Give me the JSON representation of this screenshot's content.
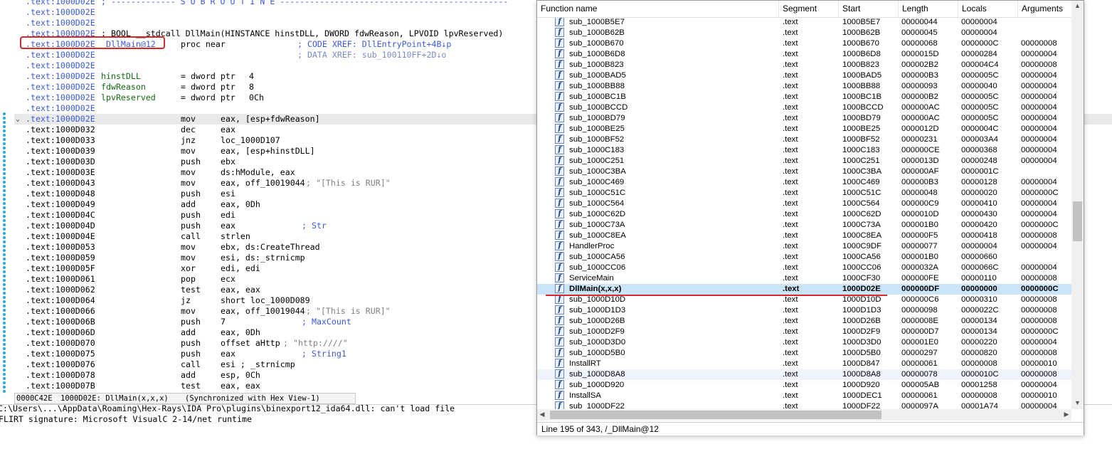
{
  "disasm": {
    "lines": [
      {
        "addr": ".text:1000D02E",
        "ab": true,
        "label": "; ------------- S U B R O U T I N E ----------------------------------------------",
        "lc": "cmt"
      },
      {
        "addr": ".text:1000D02E",
        "ab": true
      },
      {
        "addr": ".text:1000D02E",
        "ab": true
      },
      {
        "addr": ".text:1000D02E",
        "ab": true,
        "label": "; BOOL __stdcall DllMain(HINSTANCE hinstDLL, DWORD fdwReason, LPVOID lpvReserved)",
        "lc": "black"
      },
      {
        "addr": ".text:1000D02E",
        "ab": true,
        "label": "_DllMain@12",
        "lc": "blue",
        "mn": "proc near",
        "cmt": "; CODE XREF: DllEntryPoint+4B↓p",
        "cc": "xref"
      },
      {
        "addr": ".text:1000D02E",
        "ab": true,
        "cmt": "; DATA XREF: sub_100110FF+2D↓o",
        "cc": "xref2"
      },
      {
        "addr": ".text:1000D02E",
        "ab": true
      },
      {
        "addr": ".text:1000D02E",
        "ab": true,
        "label": "hinstDLL",
        "lc": "green",
        "mn": "= dword ptr",
        "op": "4"
      },
      {
        "addr": ".text:1000D02E",
        "ab": true,
        "label": "fdwReason",
        "lc": "green",
        "mn": "= dword ptr",
        "op": "8"
      },
      {
        "addr": ".text:1000D02E",
        "ab": true,
        "label": "lpvReserved",
        "lc": "green",
        "mn": "= dword ptr",
        "op": "0Ch"
      },
      {
        "addr": ".text:1000D02E",
        "ab": true
      },
      {
        "addr": ".text:1000D02E",
        "ab": true,
        "mn": "mov",
        "op": "eax, [esp+fdwReason]",
        "hl": true
      },
      {
        "addr": ".text:1000D032",
        "mn": "dec",
        "op": "eax"
      },
      {
        "addr": ".text:1000D033",
        "mn": "jnz",
        "op": "loc_1000D107"
      },
      {
        "addr": ".text:1000D039",
        "mn": "mov",
        "op": "eax, [esp+hinstDLL]"
      },
      {
        "addr": ".text:1000D03D",
        "mn": "push",
        "op": "ebx"
      },
      {
        "addr": ".text:1000D03E",
        "mn": "mov",
        "op": "ds:hModule, eax"
      },
      {
        "addr": ".text:1000D043",
        "mn": "mov",
        "op": "eax, off_10019044",
        "cmt": "; \"[This is RUR]\"",
        "cc": "str"
      },
      {
        "addr": ".text:1000D048",
        "mn": "push",
        "op": "esi"
      },
      {
        "addr": ".text:1000D049",
        "mn": "add",
        "op": "eax, 0Dh"
      },
      {
        "addr": ".text:1000D04C",
        "mn": "push",
        "op": "edi"
      },
      {
        "addr": ".text:1000D04D",
        "mn": "push",
        "op": "eax",
        "cmt": "; Str",
        "cc": "cmt"
      },
      {
        "addr": ".text:1000D04E",
        "mn": "call",
        "op": "strlen"
      },
      {
        "addr": ".text:1000D053",
        "mn": "mov",
        "op": "ebx, ds:CreateThread"
      },
      {
        "addr": ".text:1000D059",
        "mn": "mov",
        "op": "esi, ds:_strnicmp"
      },
      {
        "addr": ".text:1000D05F",
        "mn": "xor",
        "op": "edi, edi"
      },
      {
        "addr": ".text:1000D061",
        "mn": "pop",
        "op": "ecx"
      },
      {
        "addr": ".text:1000D062",
        "mn": "test",
        "op": "eax, eax"
      },
      {
        "addr": ".text:1000D064",
        "mn": "jz",
        "op": "short loc_1000D089"
      },
      {
        "addr": ".text:1000D066",
        "mn": "mov",
        "op": "eax, off_10019044",
        "cmt": "; \"[This is RUR]\"",
        "cc": "str"
      },
      {
        "addr": ".text:1000D06B",
        "mn": "push",
        "op": "7",
        "cmt": "; MaxCount",
        "cc": "cmt"
      },
      {
        "addr": ".text:1000D06D",
        "mn": "add",
        "op": "eax, 0Dh"
      },
      {
        "addr": ".text:1000D070",
        "mn": "push",
        "op": "offset aHttp",
        "cmt": "; \"http:////\"",
        "cc": "str"
      },
      {
        "addr": ".text:1000D075",
        "mn": "push",
        "op": "eax",
        "cmt": "; String1",
        "cc": "cmt"
      },
      {
        "addr": ".text:1000D076",
        "mn": "call",
        "op": "esi ; _strnicmp"
      },
      {
        "addr": ".text:1000D078",
        "mn": "add",
        "op": "esp, 0Ch"
      },
      {
        "addr": ".text:1000D07B",
        "mn": "test",
        "op": "eax, eax"
      }
    ],
    "status": {
      "offset": "0000C42E",
      "location": "1000D02E: DllMain(x,x,x)",
      "sync": "(Synchronized with Hex View-1)"
    }
  },
  "output": {
    "line1": "C:\\Users\\...\\AppData\\Roaming\\Hex-Rays\\IDA Pro\\plugins\\binexport12_ida64.dll: can't load file",
    "line2": "FLIRT signature: Microsoft VisualC 2-14/net runtime"
  },
  "functions": {
    "headers": {
      "name": "Function name",
      "segment": "Segment",
      "start": "Start",
      "length": "Length",
      "locals": "Locals",
      "arguments": "Arguments"
    },
    "rows": [
      [
        "sub_1000B5E7",
        ".text",
        "1000B5E7",
        "00000044",
        "00000004",
        ""
      ],
      [
        "sub_1000B62B",
        ".text",
        "1000B62B",
        "00000045",
        "00000004",
        ""
      ],
      [
        "sub_1000B670",
        ".text",
        "1000B670",
        "00000068",
        "0000000C",
        "00000008"
      ],
      [
        "sub_1000B6D8",
        ".text",
        "1000B6D8",
        "0000015D",
        "00000284",
        "00000004"
      ],
      [
        "sub_1000B823",
        ".text",
        "1000B823",
        "000002B2",
        "000004C4",
        "00000008"
      ],
      [
        "sub_1000BAD5",
        ".text",
        "1000BAD5",
        "000000B3",
        "0000005C",
        "00000004"
      ],
      [
        "sub_1000BB88",
        ".text",
        "1000BB88",
        "00000093",
        "00000040",
        "00000004"
      ],
      [
        "sub_1000BC1B",
        ".text",
        "1000BC1B",
        "000000B2",
        "0000005C",
        "00000004"
      ],
      [
        "sub_1000BCCD",
        ".text",
        "1000BCCD",
        "000000AC",
        "0000005C",
        "00000004"
      ],
      [
        "sub_1000BD79",
        ".text",
        "1000BD79",
        "000000AC",
        "0000005C",
        "00000004"
      ],
      [
        "sub_1000BE25",
        ".text",
        "1000BE25",
        "0000012D",
        "0000004C",
        "00000004"
      ],
      [
        "sub_1000BF52",
        ".text",
        "1000BF52",
        "00000231",
        "000003A4",
        "00000004"
      ],
      [
        "sub_1000C183",
        ".text",
        "1000C183",
        "000000CE",
        "00000368",
        "00000004"
      ],
      [
        "sub_1000C251",
        ".text",
        "1000C251",
        "0000013D",
        "00000248",
        "00000004"
      ],
      [
        "sub_1000C3BA",
        ".text",
        "1000C3BA",
        "000000AF",
        "0000001C",
        ""
      ],
      [
        "sub_1000C469",
        ".text",
        "1000C469",
        "000000B3",
        "00000128",
        "00000004"
      ],
      [
        "sub_1000C51C",
        ".text",
        "1000C51C",
        "00000048",
        "00000020",
        "0000000C"
      ],
      [
        "sub_1000C564",
        ".text",
        "1000C564",
        "000000C9",
        "00000410",
        "00000004"
      ],
      [
        "sub_1000C62D",
        ".text",
        "1000C62D",
        "0000010D",
        "00000430",
        "00000004"
      ],
      [
        "sub_1000C73A",
        ".text",
        "1000C73A",
        "000001B0",
        "00000420",
        "0000000C"
      ],
      [
        "sub_1000C8EA",
        ".text",
        "1000C8EA",
        "000000F5",
        "00000418",
        "00000008"
      ],
      [
        "HandlerProc",
        ".text",
        "1000C9DF",
        "00000077",
        "00000004",
        "00000004"
      ],
      [
        "sub_1000CA56",
        ".text",
        "1000CA56",
        "000001B0",
        "00000660",
        ""
      ],
      [
        "sub_1000CC06",
        ".text",
        "1000CC06",
        "0000032A",
        "0000066C",
        "00000004"
      ],
      [
        "ServiceMain",
        ".text",
        "1000CF30",
        "000000FE",
        "00000110",
        "00000008"
      ],
      [
        "DllMain(x,x,x)",
        ".text",
        "1000D02E",
        "000000DF",
        "00000000",
        "0000000C"
      ],
      [
        "sub_1000D10D",
        ".text",
        "1000D10D",
        "000000C6",
        "00000310",
        "00000008"
      ],
      [
        "sub_1000D1D3",
        ".text",
        "1000D1D3",
        "00000098",
        "0000022C",
        "00000008"
      ],
      [
        "sub_1000D26B",
        ".text",
        "1000D26B",
        "0000008E",
        "00000134",
        "00000008"
      ],
      [
        "sub_1000D2F9",
        ".text",
        "1000D2F9",
        "000000D7",
        "00000134",
        "0000000C"
      ],
      [
        "sub_1000D3D0",
        ".text",
        "1000D3D0",
        "000001E0",
        "00000220",
        "00000004"
      ],
      [
        "sub_1000D5B0",
        ".text",
        "1000D5B0",
        "00000297",
        "00000820",
        "00000008"
      ],
      [
        "InstallRT",
        ".text",
        "1000D847",
        "00000061",
        "00000008",
        "00000010"
      ],
      [
        "sub_1000D8A8",
        ".text",
        "1000D8A8",
        "00000078",
        "0000010C",
        "00000008"
      ],
      [
        "sub_1000D920",
        ".text",
        "1000D920",
        "000005AB",
        "00001258",
        "00000004"
      ],
      [
        "InstallSA",
        ".text",
        "1000DEC1",
        "00000061",
        "00000008",
        "00000010"
      ],
      [
        "sub_1000DF22",
        ".text",
        "1000DF22",
        "0000097A",
        "00001A74",
        "00000004"
      ]
    ],
    "selected_index": 25,
    "alt_indices": [
      33
    ],
    "status": "Line 195 of 343, /_DllMain@12"
  }
}
